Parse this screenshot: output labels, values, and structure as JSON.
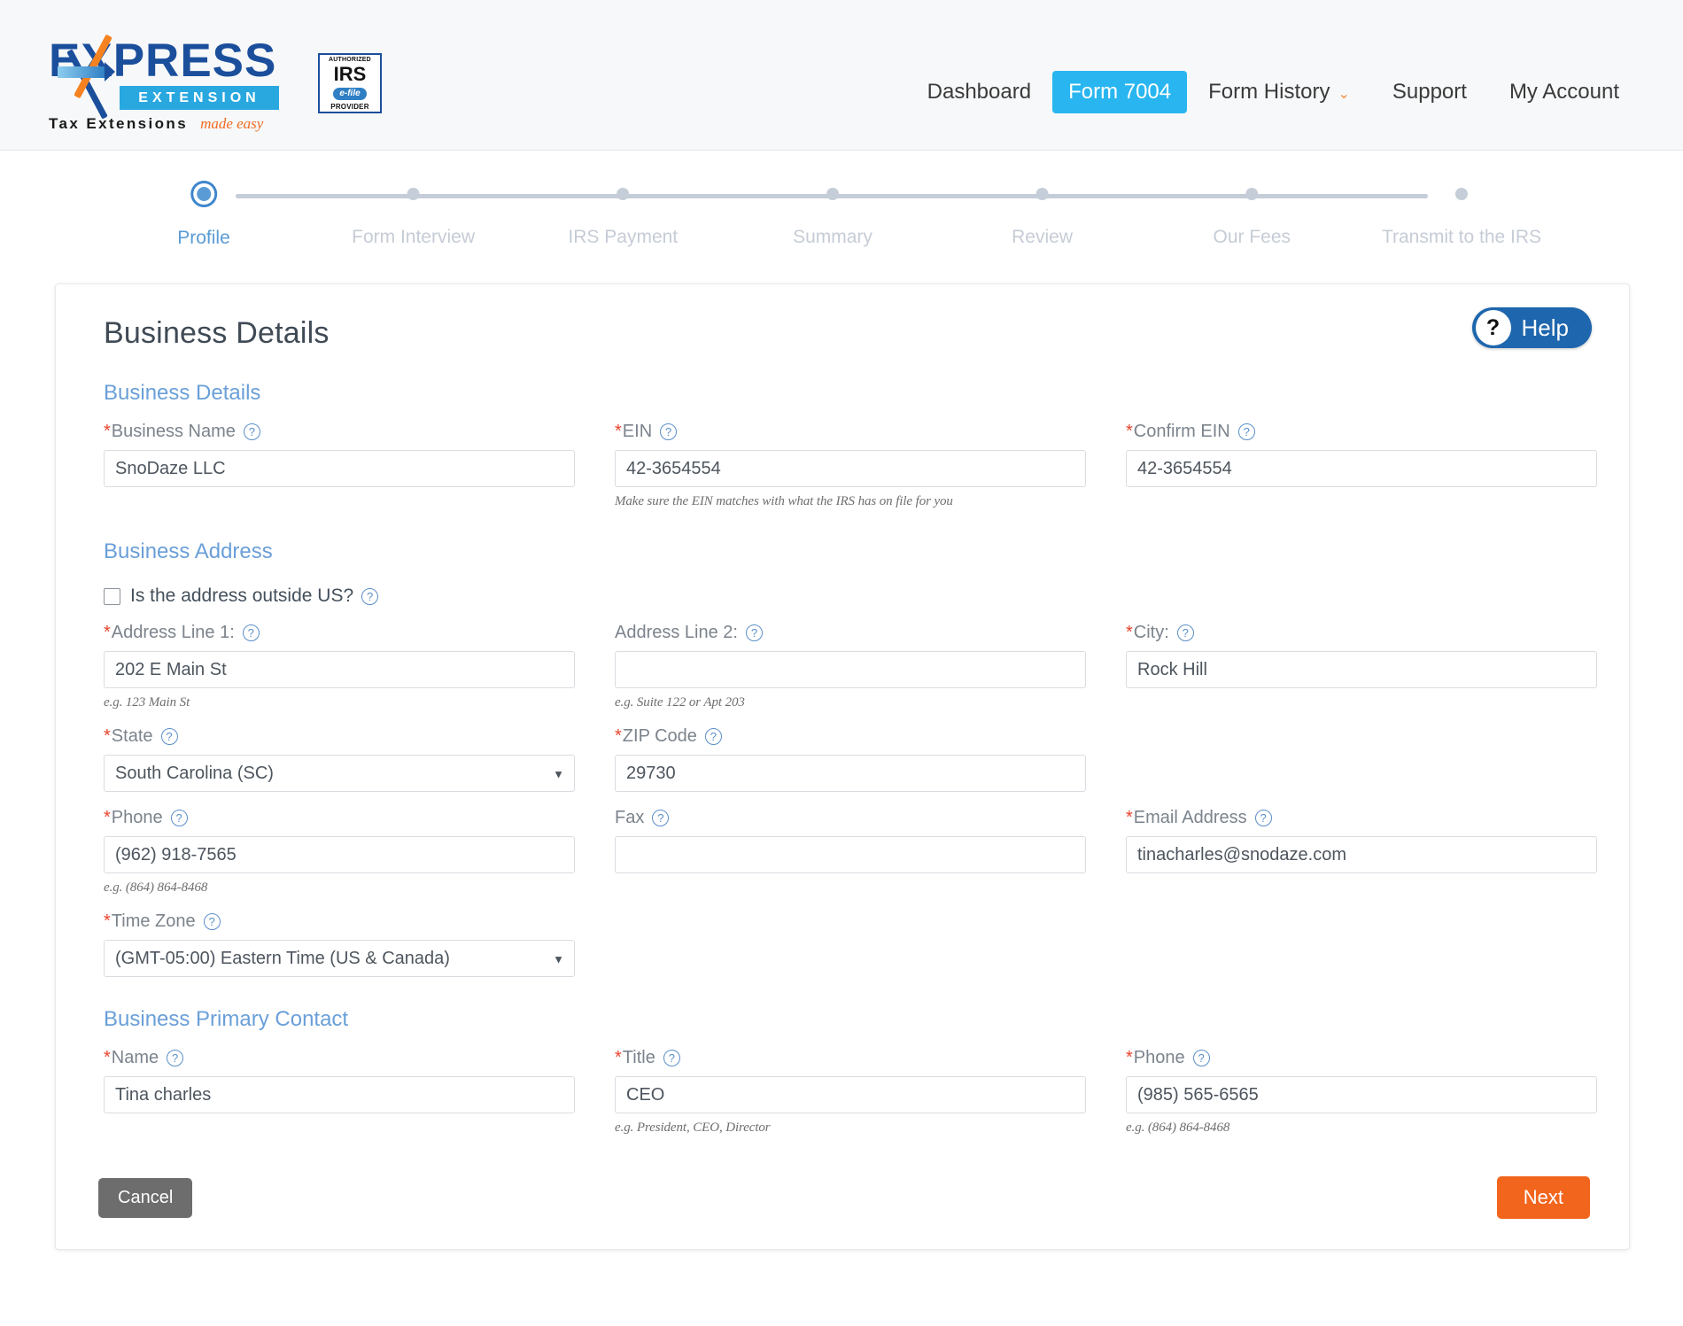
{
  "brand": {
    "name": "EXPRESS",
    "sub": "EXTENSION",
    "tagline_1": "Tax Extensions",
    "tagline_2": "made easy",
    "irs_badge": {
      "top": "AUTHORIZED",
      "main": "IRS",
      "efile": "e-file",
      "bottom": "PROVIDER"
    }
  },
  "nav": {
    "items": [
      {
        "label": "Dashboard",
        "active": false,
        "caret": false
      },
      {
        "label": "Form 7004",
        "active": true,
        "caret": false
      },
      {
        "label": "Form History",
        "active": false,
        "caret": true
      },
      {
        "label": "Support",
        "active": false,
        "caret": false
      },
      {
        "label": "My Account",
        "active": false,
        "caret": false
      }
    ],
    "caret_glyph": "⌄"
  },
  "stepper": {
    "steps": [
      {
        "label": "Profile",
        "active": true
      },
      {
        "label": "Form Interview",
        "active": false
      },
      {
        "label": "IRS Payment",
        "active": false
      },
      {
        "label": "Summary",
        "active": false
      },
      {
        "label": "Review",
        "active": false
      },
      {
        "label": "Our Fees",
        "active": false
      },
      {
        "label": "Transmit to the IRS",
        "active": false
      }
    ]
  },
  "page": {
    "title": "Business Details",
    "help_label": "Help",
    "help_icon": "?"
  },
  "sections": {
    "business_details": "Business Details",
    "business_address": "Business Address",
    "business_primary_contact": "Business Primary Contact"
  },
  "fields": {
    "business_name": {
      "label": "Business Name",
      "required": true,
      "value": "SnoDaze LLC"
    },
    "ein": {
      "label": "EIN",
      "required": true,
      "value": "42-3654554",
      "hint": "Make sure the EIN matches with what the IRS has on file for you"
    },
    "confirm_ein": {
      "label": "Confirm EIN",
      "required": true,
      "value": "42-3654554"
    },
    "outside_us": {
      "label": "Is the address outside US?",
      "checked": false
    },
    "address1": {
      "label": "Address Line 1:",
      "required": true,
      "value": "202 E Main St",
      "hint": "e.g. 123 Main St"
    },
    "address2": {
      "label": "Address Line 2:",
      "required": false,
      "value": "",
      "hint": "e.g. Suite 122 or Apt 203"
    },
    "city": {
      "label": "City:",
      "required": true,
      "value": "Rock Hill"
    },
    "state": {
      "label": "State",
      "required": true,
      "value": "South Carolina (SC)"
    },
    "zip": {
      "label": "ZIP Code",
      "required": true,
      "value": "29730"
    },
    "phone": {
      "label": "Phone",
      "required": true,
      "value": "(962) 918-7565",
      "hint": "e.g. (864) 864-8468"
    },
    "fax": {
      "label": "Fax",
      "required": false,
      "value": ""
    },
    "email": {
      "label": "Email Address",
      "required": true,
      "value": "tinacharles@snodaze.com"
    },
    "timezone": {
      "label": "Time Zone",
      "required": true,
      "value": "(GMT-05:00) Eastern Time (US & Canada)"
    },
    "contact_name": {
      "label": "Name",
      "required": true,
      "value": "Tina charles"
    },
    "contact_title": {
      "label": "Title",
      "required": true,
      "value": "CEO",
      "hint": "e.g. President, CEO, Director"
    },
    "contact_phone": {
      "label": "Phone",
      "required": true,
      "value": "(985) 565-6565",
      "hint": "e.g. (864) 864-8468"
    }
  },
  "footer": {
    "cancel_label": "Cancel",
    "next_label": "Next"
  },
  "colors": {
    "accent_blue": "#29b6f0",
    "section_blue": "#6a9fd8",
    "required_red": "#e8442c",
    "next_orange": "#f2651d",
    "cancel_gray": "#6d6d6d",
    "help_blue": "#1e66ae"
  },
  "glyphs": {
    "select_arrow": "▼",
    "asterisk": "*",
    "question": "?"
  }
}
